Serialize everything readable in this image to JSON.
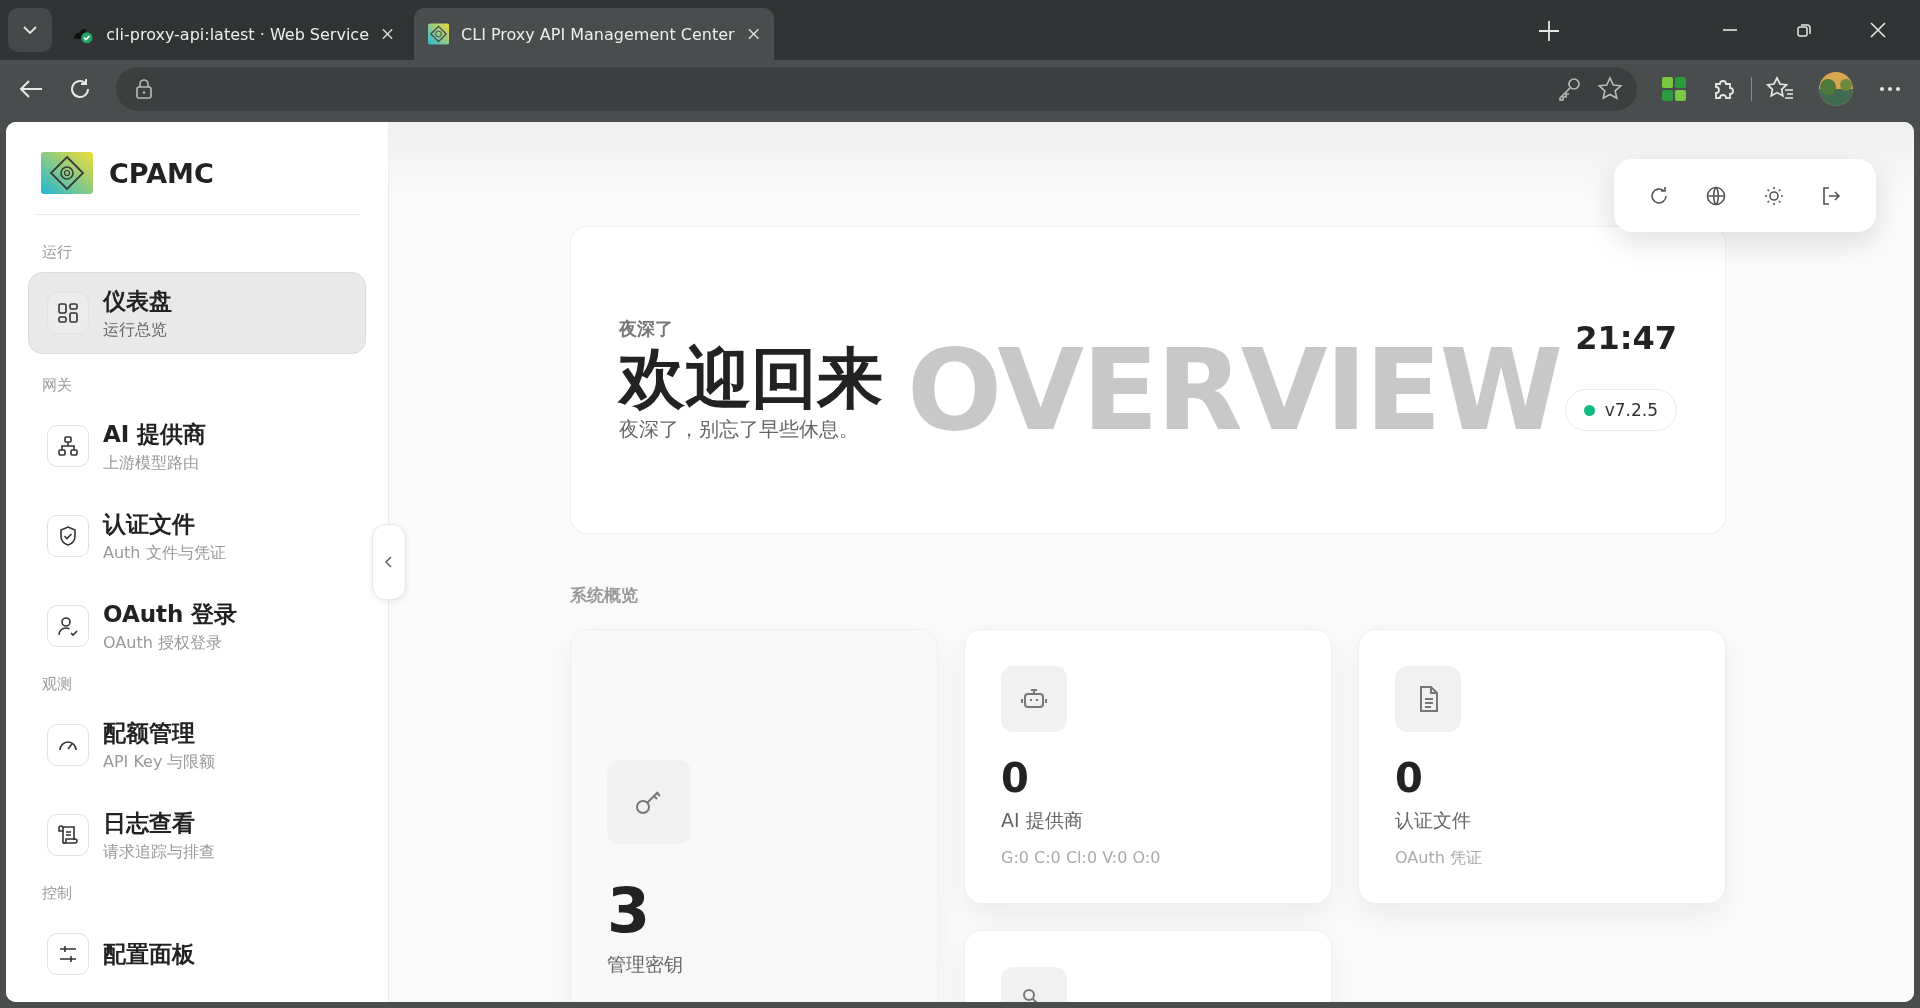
{
  "browser": {
    "tabs": [
      {
        "title": "cli-proxy-api:latest  ·  Web Service",
        "selected": false
      },
      {
        "title": "CLI Proxy API Management Center",
        "selected": true
      }
    ]
  },
  "sidebar": {
    "brand": "CPAMC",
    "sections": [
      {
        "label": "运行",
        "items": [
          {
            "title": "仪表盘",
            "subtitle": "运行总览",
            "selected": true
          }
        ]
      },
      {
        "label": "网关",
        "items": [
          {
            "title": "AI 提供商",
            "subtitle": "上游模型路由",
            "selected": false
          },
          {
            "title": "认证文件",
            "subtitle": "Auth 文件与凭证",
            "selected": false
          },
          {
            "title": "OAuth 登录",
            "subtitle": "OAuth 授权登录",
            "selected": false
          }
        ]
      },
      {
        "label": "观测",
        "items": [
          {
            "title": "配额管理",
            "subtitle": "API Key 与限额",
            "selected": false
          },
          {
            "title": "日志查看",
            "subtitle": "请求追踪与排查",
            "selected": false
          }
        ]
      },
      {
        "label": "控制",
        "items": [
          {
            "title": "配置面板",
            "selected": false
          }
        ]
      }
    ]
  },
  "hero": {
    "watermark": "OVERVIEW",
    "eyebrow": "夜深了",
    "title": "欢迎回来",
    "subtitle": "夜深了，别忘了早些休息。",
    "time": "21:47",
    "version": "v7.2.5"
  },
  "overview": {
    "heading": "系统概览",
    "cards": [
      {
        "kind": "stat",
        "value": "3",
        "label": "管理密钥"
      },
      {
        "kind": "stat",
        "value": "0",
        "label": "AI 提供商",
        "detail": "G:0 C:0 Cl:0 V:0 O:0"
      },
      {
        "kind": "stat",
        "value": "0",
        "label": "认证文件",
        "detail": "OAuth 凭证"
      },
      {
        "kind": "stat"
      }
    ]
  }
}
